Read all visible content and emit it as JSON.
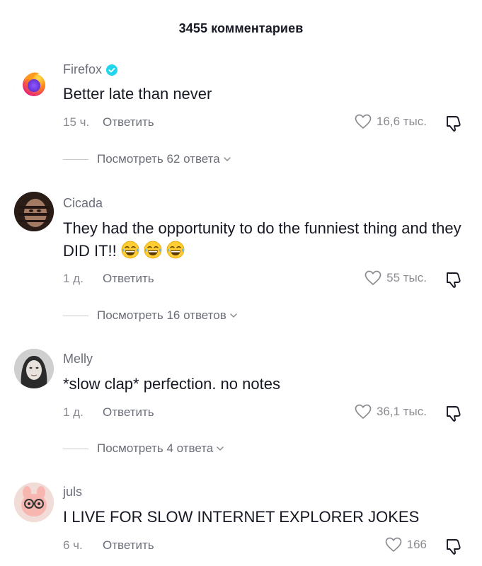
{
  "header": {
    "title": "3455 комментариев"
  },
  "comments": [
    {
      "username": "Firefox",
      "verified": true,
      "text": "Better late than never",
      "time": "15 ч.",
      "reply_label": "Ответить",
      "likes": "16,6 тыс.",
      "view_replies": "Посмотреть 62 ответа",
      "avatar_icon": "firefox-logo-icon"
    },
    {
      "username": "Cicada",
      "verified": false,
      "text": "They had the opportunity to do the funniest thing and they DID IT!!",
      "emoji": [
        "😂",
        "😂",
        "😂"
      ],
      "time": "1 д.",
      "reply_label": "Ответить",
      "likes": "55 тыс.",
      "view_replies": "Посмотреть 16 ответов"
    },
    {
      "username": "Melly",
      "verified": false,
      "text": "*slow clap* perfection. no notes",
      "time": "1 д.",
      "reply_label": "Ответить",
      "likes": "36,1 тыс.",
      "view_replies": "Посмотреть 4 ответа"
    },
    {
      "username": "juls",
      "verified": false,
      "text": "I LIVE FOR SLOW INTERNET EXPLORER JOKES",
      "time": "6 ч.",
      "reply_label": "Ответить",
      "likes": "166"
    }
  ],
  "colors": {
    "verified": "#20d5ec",
    "text_primary": "#161823",
    "text_secondary": "#8a8b91"
  }
}
